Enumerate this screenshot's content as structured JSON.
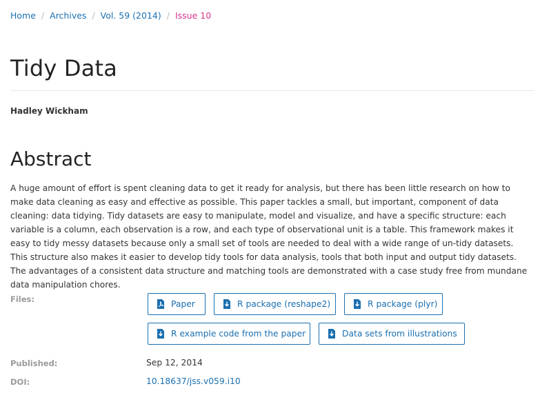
{
  "breadcrumb": {
    "items": [
      "Home",
      "Archives",
      "Vol. 59 (2014)"
    ],
    "current": "Issue 10",
    "separator": "/"
  },
  "article": {
    "title": "Tidy Data",
    "author": "Hadley Wickham",
    "abstract_heading": "Abstract",
    "abstract": "A huge amount of effort is spent cleaning data to get it ready for analysis, but there has been little research on how to make data cleaning as easy and effective as possible. This paper tackles a small, but important, component of data cleaning: data tidying. Tidy datasets are easy to manipulate, model and visualize, and have a specific structure: each variable is a column, each observation is a row, and each type of observational unit is a table. This framework makes it easy to tidy messy datasets because only a small set of tools are needed to deal with a wide range of un-tidy datasets. This structure also makes it easier to develop tidy tools for data analysis, tools that both input and output tidy datasets. The advantages of a consistent data structure and matching tools are demonstrated with a case study free from mundane data manipulation chores."
  },
  "meta": {
    "files_label": "Files:",
    "files": [
      {
        "label": "Paper",
        "icon": "pdf-icon"
      },
      {
        "label": "R package (reshape2)",
        "icon": "download-icon"
      },
      {
        "label": "R package (plyr)",
        "icon": "download-icon"
      },
      {
        "label": "R example code from the paper",
        "icon": "download-icon"
      },
      {
        "label": "Data sets from illustrations",
        "icon": "download-icon"
      }
    ],
    "published_label": "Published:",
    "published": "Sep 12, 2014",
    "doi_label": "DOI:",
    "doi": "10.18637/jss.v059.i10"
  },
  "colors": {
    "link": "#1a6fb0",
    "current_breadcrumb": "#d6338a",
    "muted_label": "#9a9a9a"
  }
}
